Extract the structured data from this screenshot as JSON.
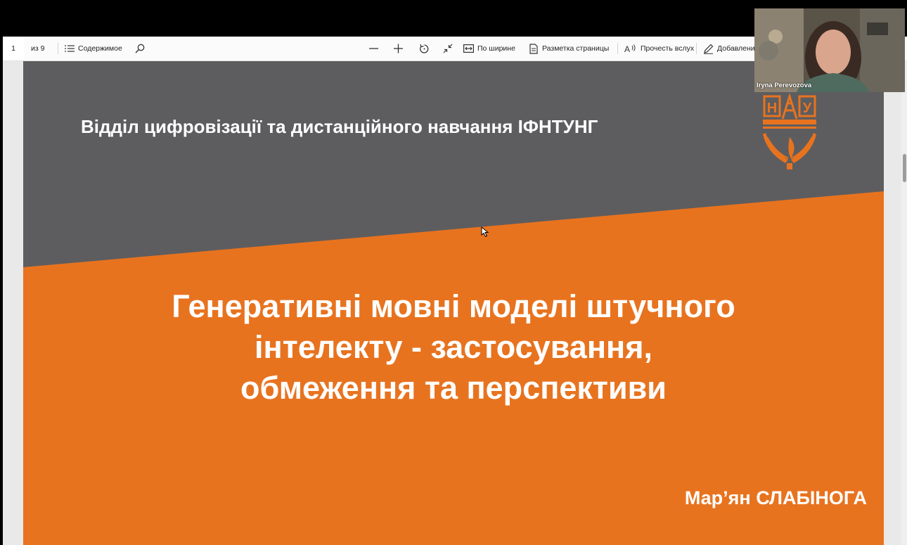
{
  "toolbar": {
    "page_number": "1",
    "page_total": "из 9",
    "contents": "Содержимое",
    "fit_width": "По ширине",
    "page_layout": "Разметка страницы",
    "read_aloud": "Прочесть вслух",
    "add_notes": "Добавление"
  },
  "slide": {
    "department": "Відділ цифровізації та дистанційного навчання ІФНТУНГ",
    "title_lines": [
      "Генеративні мовні моделі штучного",
      "інтелекту - застосування,",
      "обмеження та перспективи"
    ],
    "author": "Мар’ян СЛАБІНОГА",
    "logo_letters": [
      "Н",
      "У"
    ],
    "colors": {
      "gray": "#5d5d5f",
      "orange": "#e8731f"
    }
  },
  "video": {
    "participant_name": "Iryna Perevozova"
  }
}
